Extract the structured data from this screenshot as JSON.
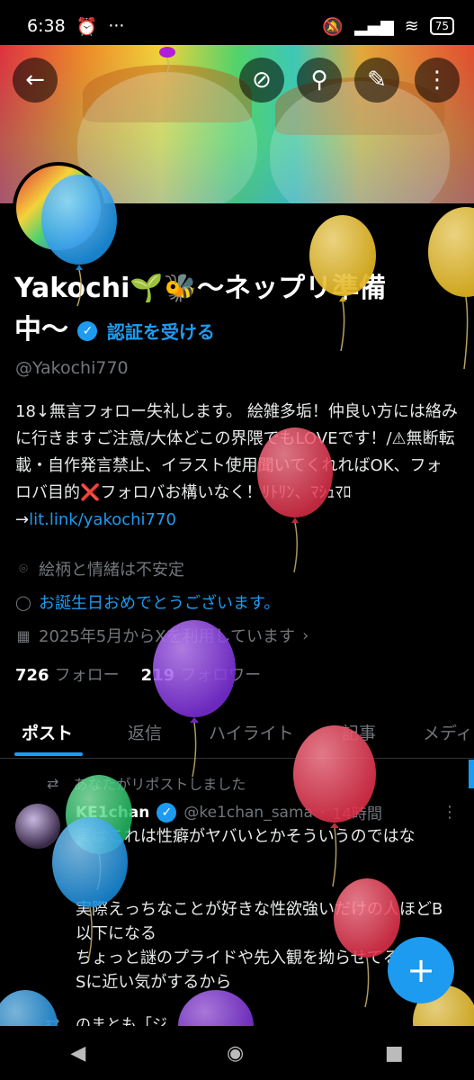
{
  "status": {
    "time": "6:38",
    "battery": "75"
  },
  "profile": {
    "name": "Yakochi🌱🐝～ネップリ準備中～",
    "verify_label": "認証を受ける",
    "handle": "@Yakochi770",
    "bio": "18↓無言フォロー失礼します。 絵雑多垢！仲良い方には絡みに行きますご注意/大体どこの界隈でもLOVEです！/⚠無断転載・自作発言禁止、イラスト使用聞いてくれればOK、フォロバ目的❌フォロバお構いなく！ﾘﾄﾘﾝ、ﾏｼｭﾏﾛ→",
    "bio_link": "lit.link/yakochi770",
    "location": "絵柄と情緒は不安定",
    "birthday": "お誕生日おめでとうございます。",
    "joined": "2025年5月からXを利用しています",
    "following_count": "726",
    "following_label": "フォロー",
    "followers_count": "219",
    "followers_label": "フォロワー"
  },
  "tabs": [
    "ポスト",
    "返信",
    "ハイライト",
    "記事",
    "メディ"
  ],
  "repost_notice": "あなたがリポストしました",
  "tweet": {
    "author": "KE1chan",
    "handle": "@ke1chan_sama",
    "time": "14時間",
    "text": "実はこれは性癖がヤバいとかそういうのではな\n\n\n実際えっちなことが好きな性欲強いだけの人ほどB以下になる\nちょっと謎のプライドや先入観を拗らせてる人ほどSに近い気がするから",
    "next_preview": "のまとも「ジ"
  },
  "fab_label": "+",
  "colors": {
    "accent": "#1d9bf0",
    "background": "#000000",
    "text": "#e7e9ea",
    "muted": "#71767b"
  },
  "icons": [
    "back-icon",
    "hide-icon",
    "search-icon",
    "edit-icon",
    "more-icon",
    "location-icon",
    "balloon-icon",
    "calendar-icon",
    "repost-icon",
    "verified-icon"
  ]
}
